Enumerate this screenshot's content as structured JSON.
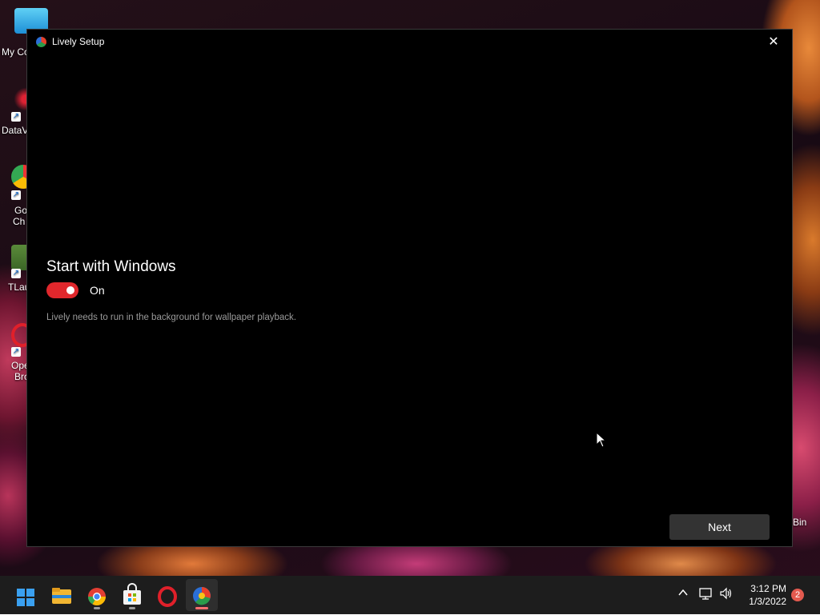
{
  "desktop": {
    "icons": [
      {
        "label": "My Co"
      },
      {
        "label": "DataV"
      },
      {
        "label": "Go"
      },
      {
        "label": "Ch"
      },
      {
        "label": "TLau"
      },
      {
        "label": "Ope"
      },
      {
        "label": "Bro"
      }
    ],
    "bin_label": "Bin"
  },
  "window": {
    "title": "Lively Setup",
    "close_glyph": "✕",
    "heading": "Start with Windows",
    "toggle": {
      "state": "on",
      "label": "On"
    },
    "description": "Lively needs to run in the background for wallpaper playback.",
    "next_label": "Next"
  },
  "taskbar": {
    "apps": [
      {
        "icon": "windows-start-icon"
      },
      {
        "icon": "file-explorer-icon"
      },
      {
        "icon": "chrome-icon"
      },
      {
        "icon": "microsoft-store-icon"
      },
      {
        "icon": "opera-icon"
      },
      {
        "icon": "lively-icon",
        "active": true
      }
    ],
    "tray": {
      "chevron": "^",
      "time": "3:12 PM",
      "date": "1/3/2022",
      "notifications": "2"
    }
  },
  "colors": {
    "accent": "#e0272c",
    "window_bg": "#000000",
    "taskbar_bg": "#1d1d1d"
  }
}
